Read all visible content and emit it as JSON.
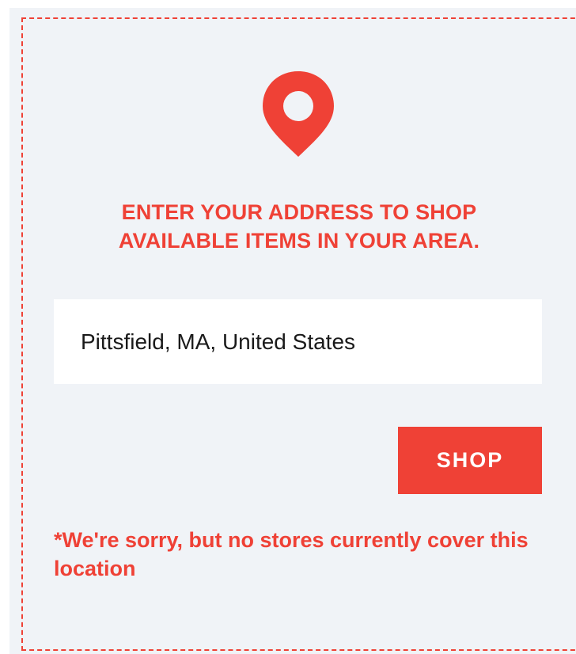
{
  "location_prompt": {
    "heading": "ENTER YOUR ADDRESS TO SHOP AVAILABLE ITEMS IN YOUR AREA.",
    "address_value": "Pittsfield, MA, United States",
    "shop_label": "SHOP",
    "error_message": "*We're sorry, but no stores currently cover this location"
  },
  "icons": {
    "location": "map-pin-icon"
  },
  "colors": {
    "accent": "#ef4136",
    "panel_background": "#f0f3f7",
    "input_background": "#ffffff",
    "button_text": "#ffffff"
  }
}
